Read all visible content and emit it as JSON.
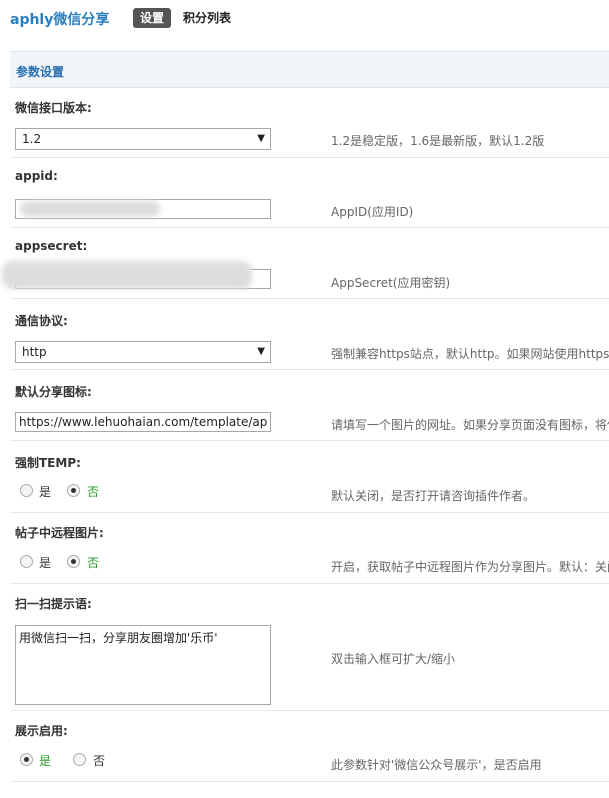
{
  "header": {
    "app_title": "aphly微信分享",
    "tabs": [
      {
        "label": "设置",
        "active": true
      },
      {
        "label": "积分列表",
        "active": false
      }
    ]
  },
  "section": {
    "title": "参数设置"
  },
  "settings": [
    {
      "label": "微信接口版本:",
      "type": "select",
      "value": "1.2",
      "desc": "1.2是稳定版，1.6是最新版，默认1.2版"
    },
    {
      "label": "appid:",
      "type": "input",
      "value": "",
      "desc": "AppID(应用ID)"
    },
    {
      "label": "appsecret:",
      "type": "input",
      "value": "",
      "desc": "AppSecret(应用密钥)"
    },
    {
      "label": "通信协议:",
      "type": "select",
      "value": "http",
      "desc": "强制兼容https站点，默认http。如果网站使用https"
    },
    {
      "label": "默认分享图标:",
      "type": "input",
      "value": "https://www.lehuohaian.com/template/ap",
      "desc": "请填写一个图片的网址。如果分享页面没有图标，将使"
    },
    {
      "label": "强制TEMP:",
      "type": "radio",
      "options": [
        "是",
        "否"
      ],
      "selected": "否",
      "desc": "默认关闭，是否打开请咨询插件作者。"
    },
    {
      "label": "帖子中远程图片:",
      "type": "radio",
      "options": [
        "是",
        "否"
      ],
      "selected": "否",
      "desc": "开启，获取帖子中远程图片作为分享图片。默认：关闭"
    },
    {
      "label": "扫一扫提示语:",
      "type": "textarea",
      "value": "用微信扫一扫，分享朋友圈增加'乐币'",
      "desc": "双击输入框可扩大/缩小"
    },
    {
      "label": "展示启用:",
      "type": "radio",
      "options": [
        "是",
        "否"
      ],
      "selected": "是",
      "desc": "此参数针对'微信公众号展示'，是否启用"
    }
  ],
  "icons": {
    "select_arrow": "chevron-down-icon"
  },
  "colors": {
    "title": "#2a7fbf",
    "section_bg": "#f2f6fb",
    "selected_text": "#2a9a2a"
  }
}
